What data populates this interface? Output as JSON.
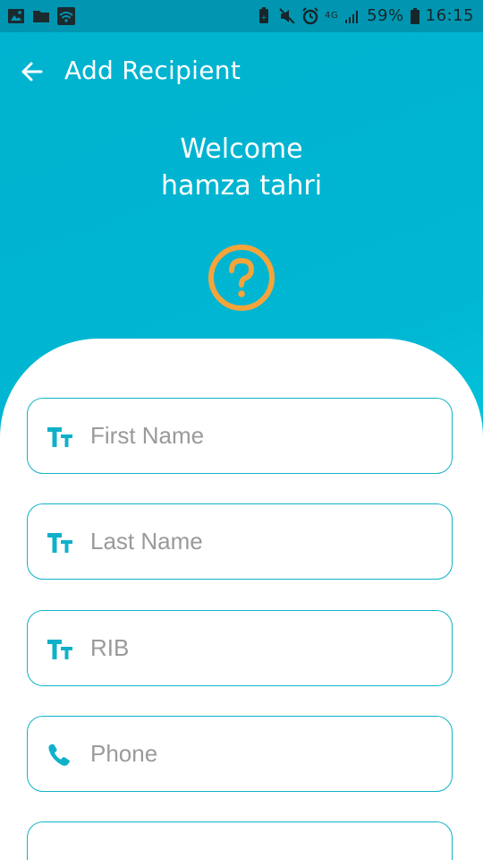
{
  "status_bar": {
    "battery": "59%",
    "time": "16:15",
    "network": "4G"
  },
  "app_bar": {
    "title": "Add Recipient",
    "back_icon": "arrow-left-icon"
  },
  "welcome": {
    "line1": "Welcome",
    "line2": "hamza tahri"
  },
  "help_icon": "help-circle-icon",
  "form": {
    "fields": [
      {
        "placeholder": "First Name",
        "value": "",
        "icon": "text-size-icon"
      },
      {
        "placeholder": "Last Name",
        "value": "",
        "icon": "text-size-icon"
      },
      {
        "placeholder": "RIB",
        "value": "",
        "icon": "text-size-icon"
      },
      {
        "placeholder": "Phone",
        "value": "",
        "icon": "phone-icon"
      }
    ]
  },
  "colors": {
    "primary": "#00b3cf",
    "accent": "#f5a43a",
    "field_border": "#12b2c9",
    "status_bar": "#0096b1"
  }
}
